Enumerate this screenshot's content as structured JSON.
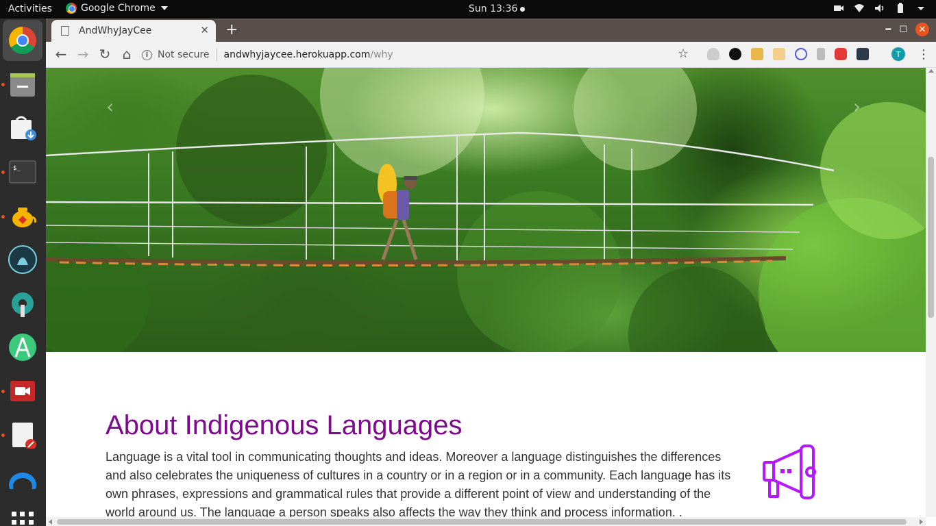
{
  "system": {
    "activities_label": "Activities",
    "app_name": "Google Chrome",
    "clock": "Sun 13:36"
  },
  "dock": {
    "items": [
      {
        "name": "chrome",
        "icon": "chrome-icon",
        "active": true
      },
      {
        "name": "files",
        "icon": "files-icon"
      },
      {
        "name": "software",
        "icon": "download-bag-icon"
      },
      {
        "name": "terminal",
        "icon": "terminal-icon"
      },
      {
        "name": "teapot",
        "icon": "teapot-icon"
      },
      {
        "name": "gitkraken",
        "icon": "kraken-icon"
      },
      {
        "name": "settings",
        "icon": "wrench-gear-icon"
      },
      {
        "name": "android-studio",
        "icon": "android-studio-icon"
      },
      {
        "name": "recorder",
        "icon": "video-camera-icon"
      },
      {
        "name": "editor",
        "icon": "document-edit-icon"
      },
      {
        "name": "app",
        "icon": "blue-swoosh-icon"
      }
    ]
  },
  "browser": {
    "tab_title": "AndWhyJayCee",
    "new_tab_label": "+",
    "security_label": "Not secure",
    "url_host": "andwhyjaycee.herokuapp.com",
    "url_path": "/why",
    "profile_initial": "T"
  },
  "content": {
    "title": "About Indigenous Languages",
    "body": "Language is a vital tool in communicating thoughts and ideas. Moreover a language distinguishes the differences and also celebrates the uniqueness of cultures in a country or in a region or in a community. Each language has its own phrases, expressions and grammatical rules that provide a different point of view and understanding of the world around us. The language a person speaks also affects the way they think and process information. .",
    "hero_icon": "rope-bridge-jungle-photo",
    "side_icon": "megaphone-icon",
    "accent_color": "#7e0a8c",
    "megaphone_color": "#b517ff"
  }
}
